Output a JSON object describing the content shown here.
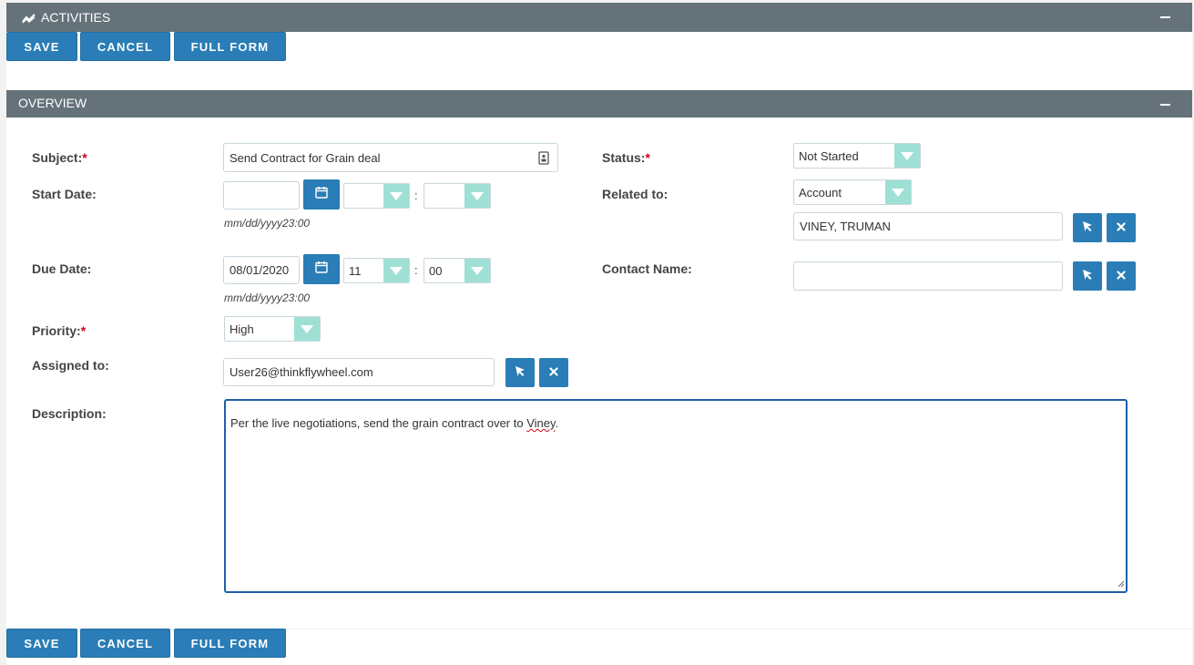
{
  "activities_panel": {
    "title": "ACTIVITIES"
  },
  "toolbar_top": {
    "save_label": "SAVE",
    "cancel_label": "CANCEL",
    "full_form_label": "FULL FORM"
  },
  "overview_panel": {
    "title": "OVERVIEW"
  },
  "form": {
    "subject": {
      "label": "Subject:",
      "required": "*",
      "value": "Send Contract for Grain deal"
    },
    "start_date": {
      "label": "Start Date:",
      "date_value": "",
      "hour_value": "",
      "minute_value": "",
      "time_separator": ":",
      "hint": "mm/dd/yyyy23:00"
    },
    "due_date": {
      "label": "Due Date:",
      "date_value": "08/01/2020",
      "hour_value": "11",
      "minute_value": "00",
      "time_separator": ":",
      "hint": "mm/dd/yyyy23:00"
    },
    "priority": {
      "label": "Priority:",
      "required": "*",
      "value": "High"
    },
    "assigned_to": {
      "label": "Assigned to:",
      "value": "User26@thinkflywheel.com"
    },
    "description": {
      "label": "Description:",
      "text_before": "Per the live negotiations, send the grain contract over to ",
      "text_misspelled": "Viney",
      "text_after": "."
    },
    "status": {
      "label": "Status:",
      "required": "*",
      "value": "Not Started"
    },
    "related_to": {
      "label": "Related to:",
      "type_value": "Account",
      "record_value": "VINEY, TRUMAN"
    },
    "contact_name": {
      "label": "Contact Name:",
      "value": ""
    }
  },
  "toolbar_bottom": {
    "save_label": "SAVE",
    "cancel_label": "CANCEL",
    "full_form_label": "FULL FORM"
  },
  "colors": {
    "header_bar": "#65727a",
    "primary_button": "#2a7db6",
    "select_arrow": "#9fe0d5",
    "required_star": "#d0021b"
  },
  "icons": {
    "activities": "activity-chart-icon",
    "collapse": "minus-icon",
    "calendar": "calendar-icon",
    "select": "cursor-arrow-icon",
    "clear": "close-x-icon",
    "field_card": "contact-card-icon"
  }
}
